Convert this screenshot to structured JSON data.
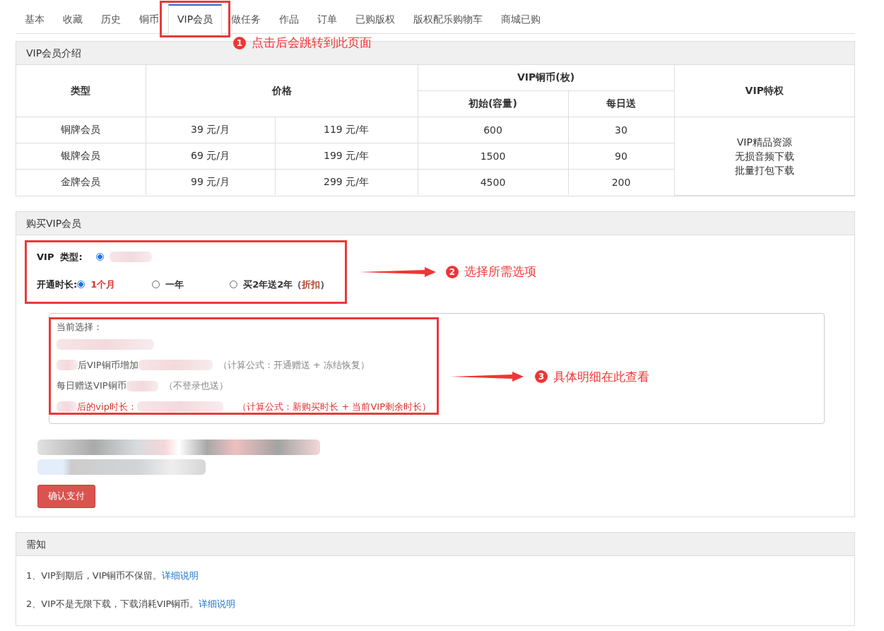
{
  "tabs": [
    {
      "label": "基本",
      "selected": false
    },
    {
      "label": "收藏",
      "selected": false
    },
    {
      "label": "历史",
      "selected": false
    },
    {
      "label": "铜币",
      "selected": false
    },
    {
      "label": "VIP会员",
      "selected": true
    },
    {
      "label": "做任务",
      "selected": false
    },
    {
      "label": "作品",
      "selected": false
    },
    {
      "label": "订单",
      "selected": false
    },
    {
      "label": "已购版权",
      "selected": false
    },
    {
      "label": "版权配乐购物车",
      "selected": false
    },
    {
      "label": "商城已购",
      "selected": false
    }
  ],
  "intro_panel": {
    "title": "VIP会员介绍",
    "header": {
      "type": "类型",
      "price": "价格",
      "coins": "VIP铜币(枚)",
      "initial": "初始(容量)",
      "daily": "每日送",
      "privileges": "VIP特权"
    },
    "rows": [
      {
        "type": "铜牌会员",
        "monthly": "39 元/月",
        "yearly": "119 元/年",
        "initial": "600",
        "daily": "30"
      },
      {
        "type": "银牌会员",
        "monthly": "69 元/月",
        "yearly": "199 元/年",
        "initial": "1500",
        "daily": "90"
      },
      {
        "type": "金牌会员",
        "monthly": "99 元/月",
        "yearly": "299 元/年",
        "initial": "4500",
        "daily": "200"
      }
    ],
    "privileges": [
      "VIP精品资源",
      "无损音频下载",
      "批量打包下载"
    ]
  },
  "purchase_panel": {
    "title": "购买VIP会员",
    "type_label": "VIP  类型:",
    "type_options": [
      {
        "selected": true
      }
    ],
    "duration_label": "开通时长:",
    "duration_options": [
      {
        "label": "1个月",
        "selected": true
      },
      {
        "label": "一年",
        "selected": false
      },
      {
        "label": "买2年送2年（",
        "note": "折扣",
        "suffix": "）",
        "selected": false
      }
    ],
    "summary": {
      "title": "当前选择：",
      "lines": [
        {
          "kind": "redacted"
        },
        {
          "kind": "coins",
          "text": "后VIP铜币增加",
          "formula": "（计算公式：开通赠送 + 冻结恢复）"
        },
        {
          "kind": "daily",
          "text": "每日赠送VIP铜币",
          "formula": "（不登录也送）"
        },
        {
          "kind": "duration",
          "text": "后的vip时长：",
          "formula": "（计算公式：新购买时长 + 当前VIP剩余时长）"
        }
      ]
    },
    "confirm_button": "确认支付"
  },
  "notice_panel": {
    "title": "需知",
    "items": [
      {
        "text": "1、VIP到期后，VIP铜币不保留。",
        "link": "详细说明"
      },
      {
        "text": "2、VIP不是无限下载，下载消耗VIP铜币。",
        "link": "详细说明"
      }
    ]
  },
  "annotations": [
    {
      "number": "1",
      "text": "点击后会跳转到此页面"
    },
    {
      "number": "2",
      "text": "选择所需选项"
    },
    {
      "number": "3",
      "text": "具体明细在此查看"
    }
  ]
}
